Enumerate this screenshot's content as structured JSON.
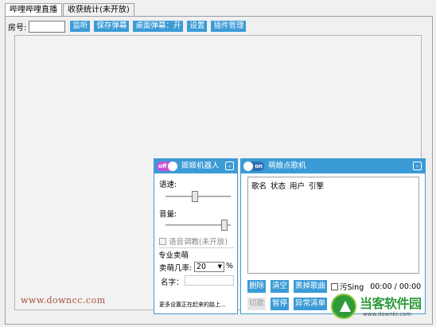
{
  "tabs": [
    {
      "label": "哔哩哔哩直播"
    },
    {
      "label": "收获统计(未开放)"
    }
  ],
  "toolbar": {
    "room_label": "房号:",
    "room_value": "",
    "buttons": [
      {
        "label": "监听"
      },
      {
        "label": "保存弹幕"
      },
      {
        "label": "桌面弹幕：开"
      },
      {
        "label": "设置"
      },
      {
        "label": "插件管理"
      }
    ]
  },
  "robot_panel": {
    "toggle_text": "off",
    "title": "姬姬机器人",
    "speed_label": "语速:",
    "speed_level": 0.45,
    "volume_label": "音量:",
    "volume_level": 0.95,
    "voice_tune_label": "语音调教(未开放)",
    "pro_group_label": "专业卖萌",
    "moe_rate_label": "卖萌几率:",
    "moe_rate_value": "20",
    "moe_rate_unit": "%",
    "name_label": "名字：",
    "name_value": "",
    "tip": "更多设置正在赶来的路上..."
  },
  "song_panel": {
    "toggle_text": "on",
    "title": "萌娘点歌机",
    "columns": [
      "歌名",
      "状态",
      "用户",
      "引擎"
    ],
    "buttons_row1": [
      {
        "label": "删除",
        "enabled": true
      },
      {
        "label": "清空",
        "enabled": true
      },
      {
        "label": "黑掉歌曲",
        "enabled": true
      }
    ],
    "buttons_row2": [
      {
        "label": "切歌",
        "enabled": false
      },
      {
        "label": "暂停",
        "enabled": true
      },
      {
        "label": "异常清单",
        "enabled": true
      }
    ],
    "sing_label": "污Sing",
    "time": "00:00 / 00:00"
  },
  "watermarks": {
    "left": "www.downcc.com",
    "logo_text": "当客软件园",
    "logo_url": "www.downkr.com"
  },
  "colors": {
    "accent": "#3b9bd6",
    "off_toggle": "#c94fd8",
    "logo_green": "#2e9a3a"
  }
}
